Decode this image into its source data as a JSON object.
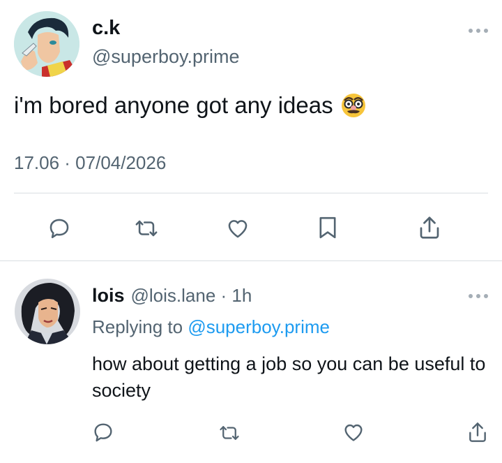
{
  "tweet": {
    "display_name": "c.k",
    "handle": "@superboy.prime",
    "text": "i'm bored anyone got any ideas",
    "emoji": "🥸",
    "timestamp": "17.06 · 07/04/2026",
    "more_icon": "more-horizontal-icon",
    "actions": [
      "reply-icon",
      "retweet-icon",
      "like-icon",
      "bookmark-icon",
      "share-icon"
    ]
  },
  "reply": {
    "display_name": "lois",
    "meta": "@lois.lane · 1h",
    "replying_prefix": "Replying to",
    "replying_handle": "@superboy.prime",
    "text": "how about getting a job so you can be useful to society",
    "more_icon": "more-horizontal-icon",
    "actions": [
      "reply-icon",
      "retweet-icon",
      "like-icon",
      "share-icon"
    ]
  },
  "colors": {
    "text": "#0f1419",
    "secondary": "#536471",
    "link": "#1d9bf0",
    "divider": "#d9dee2",
    "icon": "#536471"
  }
}
